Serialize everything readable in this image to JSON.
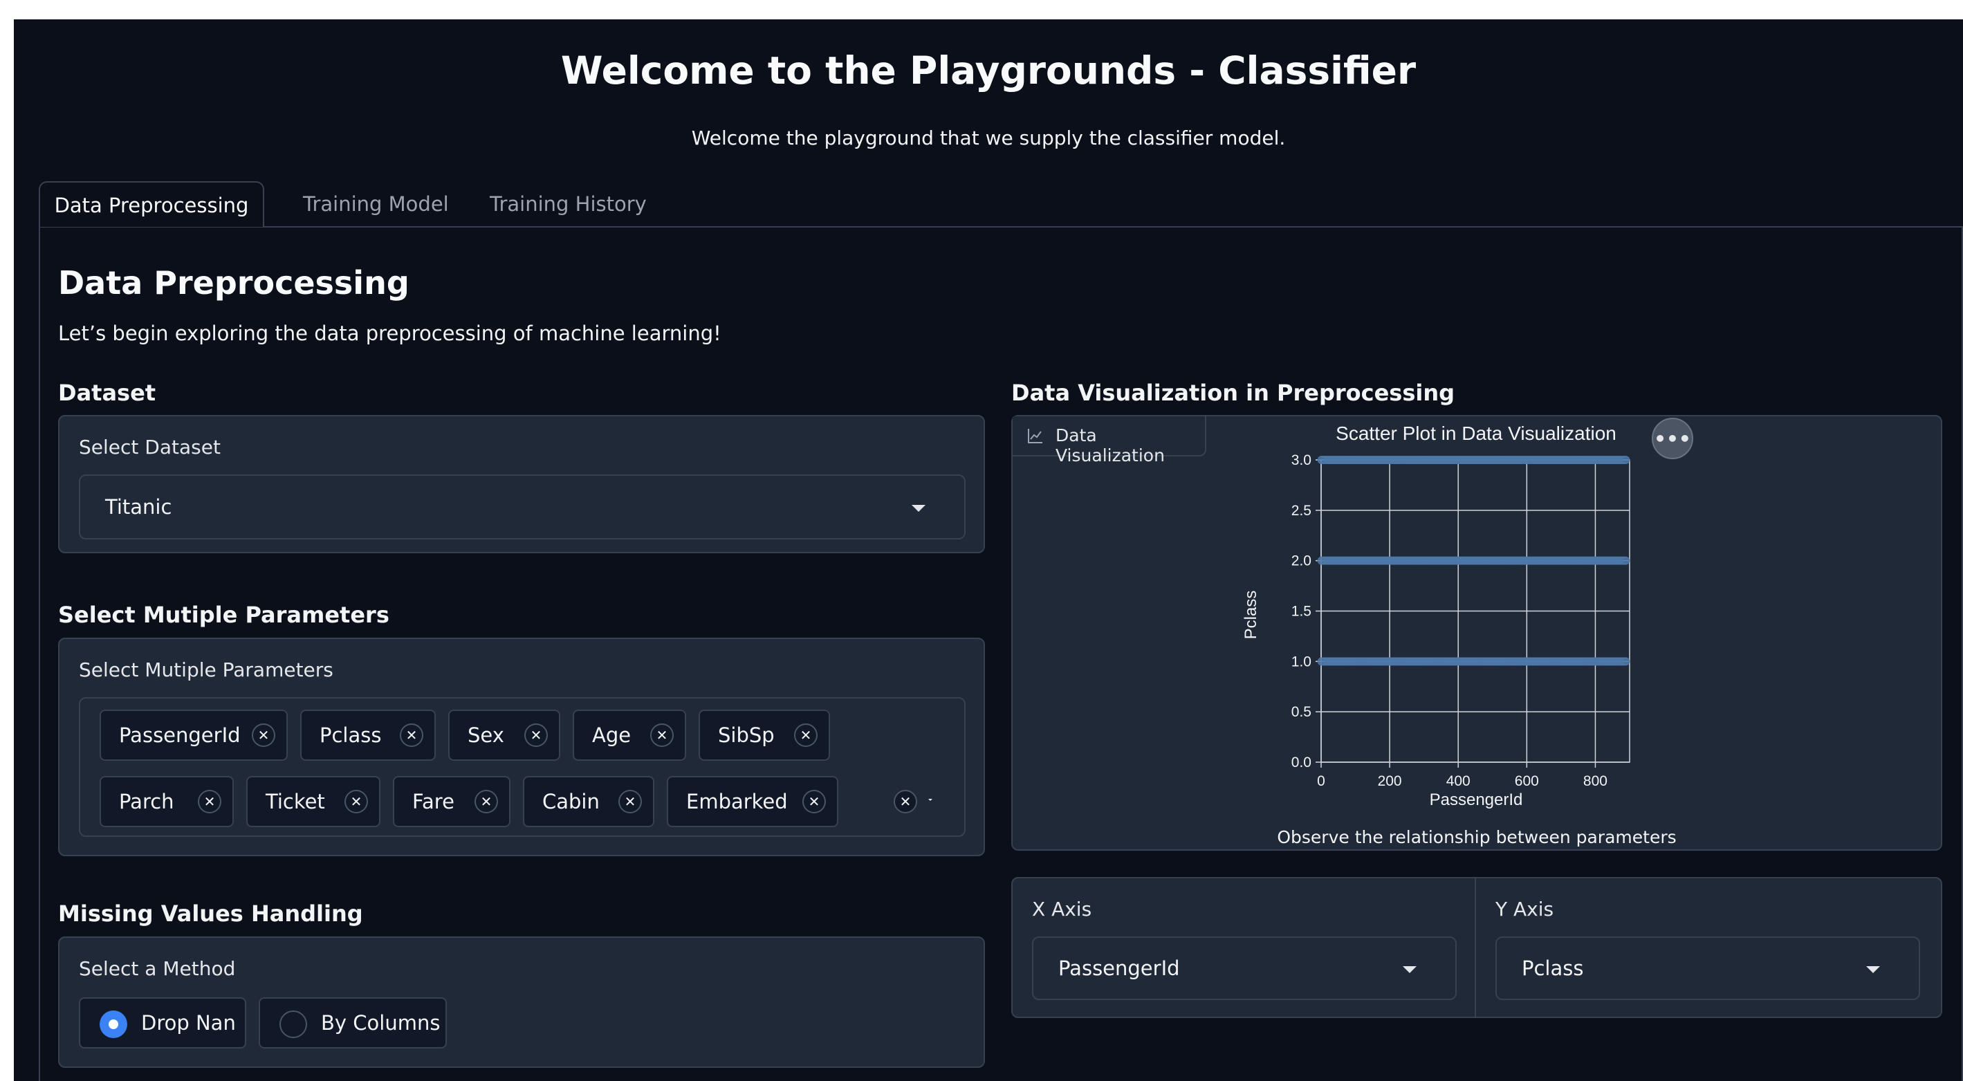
{
  "header": {
    "title": "Welcome to the Playgrounds - Classifier",
    "subtitle": "Welcome the playground that we supply the classifier model."
  },
  "tabs": [
    {
      "label": "Data Preprocessing",
      "active": true
    },
    {
      "label": "Training Model",
      "active": false
    },
    {
      "label": "Training History",
      "active": false
    }
  ],
  "panel": {
    "heading": "Data Preprocessing",
    "intro": "Let’s begin exploring the data preprocessing of machine learning!"
  },
  "dataset": {
    "section_title": "Dataset",
    "label": "Select Dataset",
    "value": "Titanic"
  },
  "parameters": {
    "section_title": "Select Mutiple Parameters",
    "label": "Select Mutiple Parameters",
    "chips": [
      "PassengerId",
      "Pclass",
      "Sex",
      "Age",
      "SibSp",
      "Parch",
      "Ticket",
      "Fare",
      "Cabin",
      "Embarked"
    ]
  },
  "missing": {
    "section_title": "Missing Values Handling",
    "label": "Select a Method",
    "options": [
      {
        "label": "Drop Nan",
        "selected": true
      },
      {
        "label": "By Columns",
        "selected": false
      }
    ]
  },
  "visualization": {
    "section_title": "Data Visualization in Preprocessing",
    "tag_label": "Data Visualization",
    "more_label": "•••",
    "caption": "Observe the relationship between parameters",
    "x_axis_label": "X Axis",
    "x_axis_value": "PassengerId",
    "y_axis_label": "Y Axis",
    "y_axis_value": "Pclass"
  },
  "colors": {
    "background": "#0b0f19",
    "panel": "#1f2937",
    "border": "#374151",
    "accent": "#3b82f6",
    "point": "#4c78a8"
  },
  "chart_data": {
    "type": "scatter",
    "title": "Scatter Plot in Data Visualization",
    "xlabel": "PassengerId",
    "ylabel": "Pclass",
    "xlim": [
      0,
      900
    ],
    "ylim": [
      0,
      3
    ],
    "xticks": [
      0,
      200,
      400,
      600,
      800
    ],
    "yticks": [
      "0.0",
      "0.5",
      "1.0",
      "1.5",
      "2.0",
      "2.5",
      "3.0"
    ],
    "grid": true,
    "series": [
      {
        "x_range": [
          1,
          891
        ],
        "y": 3
      },
      {
        "x_range": [
          1,
          891
        ],
        "y": 2
      },
      {
        "x_range": [
          1,
          891
        ],
        "y": 1
      }
    ]
  }
}
